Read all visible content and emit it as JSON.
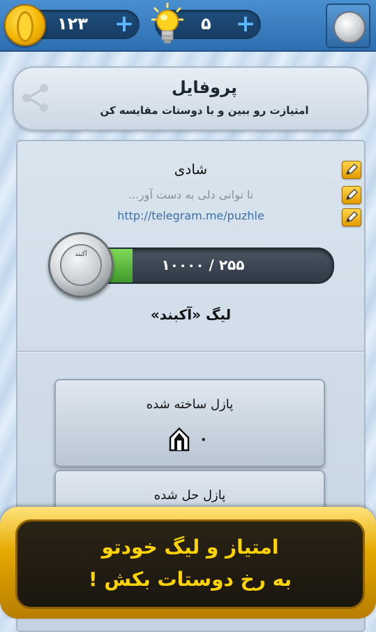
{
  "topbar": {
    "coins": "۱۲۳",
    "hints": "۵",
    "plus": "+"
  },
  "header": {
    "title": "پروفایل",
    "subtitle": "امتیازت رو ببین و با دوستات مقایسه کن"
  },
  "profile": {
    "name": "شادی",
    "status": "تا توانی دلی به دست آور...",
    "link": "http://telegram.me/puzhle",
    "progress_text": "۲۵۵ / ۱۰۰۰۰",
    "progress_value": 255,
    "progress_max": 10000,
    "medal_label": "آکبند",
    "league": "لیگ «آکبند»"
  },
  "stats": [
    {
      "title": "پازل ساخته شده",
      "value": "۰"
    },
    {
      "title": "پازل حل شده"
    }
  ],
  "banner": {
    "line1": "امتیاز و لیگ خودتو",
    "line2": "به رخ دوستات بکش !"
  },
  "colors": {
    "accent_blue": "#2d6fb0",
    "gold": "#e4a900",
    "banner_text": "#ffd400",
    "progress_green": "#5fbf3e"
  },
  "icons": {
    "coin": "coin-icon",
    "hint": "lightbulb-icon",
    "share": "share-icon",
    "edit": "pencil-icon",
    "medal": "medal-icon",
    "puzzle_created": "pencil-trophy-icon"
  }
}
